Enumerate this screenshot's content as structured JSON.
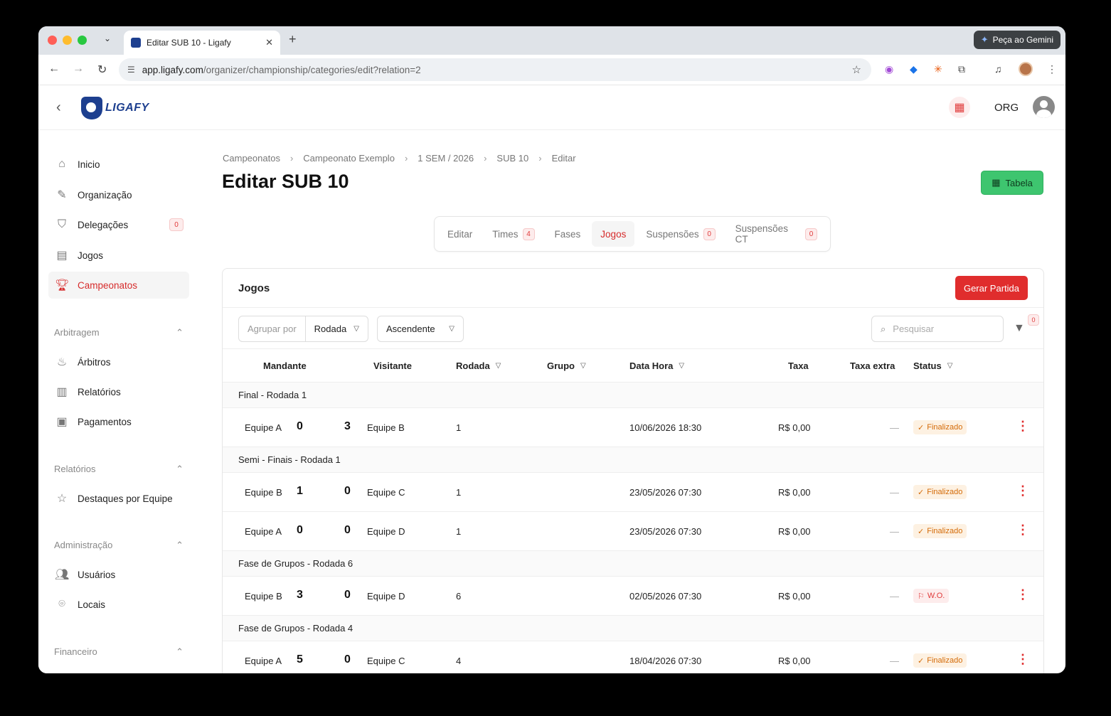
{
  "browser": {
    "tab_title": "Editar SUB 10 - Ligafy",
    "url_host": "app.ligafy.com",
    "url_path": "/organizer/championship/categories/edit?relation=2",
    "gemini_label": "Peça ao Gemini"
  },
  "header": {
    "logo_text": "LIGAFY",
    "org_label": "ORG"
  },
  "sidebar": {
    "items": [
      {
        "label": "Inicio",
        "icon": "home-icon"
      },
      {
        "label": "Organização",
        "icon": "edit-icon"
      },
      {
        "label": "Delegações",
        "icon": "shield-icon",
        "badge": "0"
      },
      {
        "label": "Jogos",
        "icon": "calendar-icon"
      },
      {
        "label": "Campeonatos",
        "icon": "trophy-icon",
        "active": true
      }
    ],
    "sections": [
      {
        "title": "Arbitragem",
        "items": [
          {
            "label": "Árbitros",
            "icon": "whistle-icon"
          },
          {
            "label": "Relatórios",
            "icon": "report-icon"
          },
          {
            "label": "Pagamentos",
            "icon": "money-icon"
          }
        ]
      },
      {
        "title": "Relatórios",
        "items": [
          {
            "label": "Destaques por Equipe",
            "icon": "star-icon"
          }
        ]
      },
      {
        "title": "Administração",
        "items": [
          {
            "label": "Usuários",
            "icon": "users-icon"
          },
          {
            "label": "Locais",
            "icon": "location-icon"
          }
        ]
      },
      {
        "title": "Financeiro",
        "items": []
      }
    ]
  },
  "breadcrumb": [
    "Campeonatos",
    "Campeonato Exemplo",
    "1 SEM / 2026",
    "SUB 10",
    "Editar"
  ],
  "page": {
    "title": "Editar SUB 10",
    "tabela_label": "Tabela"
  },
  "tabs": [
    {
      "label": "Editar"
    },
    {
      "label": "Times",
      "badge": "4"
    },
    {
      "label": "Fases"
    },
    {
      "label": "Jogos",
      "active": true
    },
    {
      "label": "Suspensões",
      "badge": "0"
    },
    {
      "label": "Suspensões CT",
      "badge": "0"
    }
  ],
  "card": {
    "title": "Jogos",
    "generate_label": "Gerar Partida",
    "groupby_label": "Agrupar por",
    "groupby_value": "Rodada",
    "order_value": "Ascendente",
    "search_placeholder": "Pesquisar",
    "filter_count": "0"
  },
  "columns": {
    "mandante": "Mandante",
    "visitante": "Visitante",
    "rodada": "Rodada",
    "grupo": "Grupo",
    "data_hora": "Data Hora",
    "taxa": "Taxa",
    "taxa_extra": "Taxa extra",
    "status": "Status"
  },
  "groups": [
    {
      "title": "Final - Rodada 1",
      "games": [
        {
          "home": "Equipe A",
          "home_score": "0",
          "away_score": "3",
          "away": "Equipe B",
          "round": "1",
          "datetime": "10/06/2026 18:30",
          "fee": "R$ 0,00",
          "extra": "—",
          "status": "Finalizado"
        }
      ]
    },
    {
      "title": "Semi - Finais - Rodada 1",
      "games": [
        {
          "home": "Equipe B",
          "home_score": "1",
          "away_score": "0",
          "away": "Equipe C",
          "round": "1",
          "datetime": "23/05/2026 07:30",
          "fee": "R$ 0,00",
          "extra": "—",
          "status": "Finalizado"
        },
        {
          "home": "Equipe A",
          "home_score": "0",
          "away_score": "0",
          "away": "Equipe D",
          "round": "1",
          "datetime": "23/05/2026 07:30",
          "fee": "R$ 0,00",
          "extra": "—",
          "status": "Finalizado"
        }
      ]
    },
    {
      "title": "Fase de Grupos - Rodada 6",
      "games": [
        {
          "home": "Equipe B",
          "home_score": "3",
          "away_score": "0",
          "away": "Equipe D",
          "round": "6",
          "datetime": "02/05/2026 07:30",
          "fee": "R$ 0,00",
          "extra": "—",
          "status": "W.O."
        }
      ]
    },
    {
      "title": "Fase de Grupos - Rodada 4",
      "games": [
        {
          "home": "Equipe A",
          "home_score": "5",
          "away_score": "0",
          "away": "Equipe C",
          "round": "4",
          "datetime": "18/04/2026 07:30",
          "fee": "R$ 0,00",
          "extra": "—",
          "status": "Finalizado"
        }
      ]
    }
  ],
  "colors": {
    "accent_red": "#e02d2d",
    "success_green": "#3ec56f",
    "status_orange": "#d46b08"
  }
}
